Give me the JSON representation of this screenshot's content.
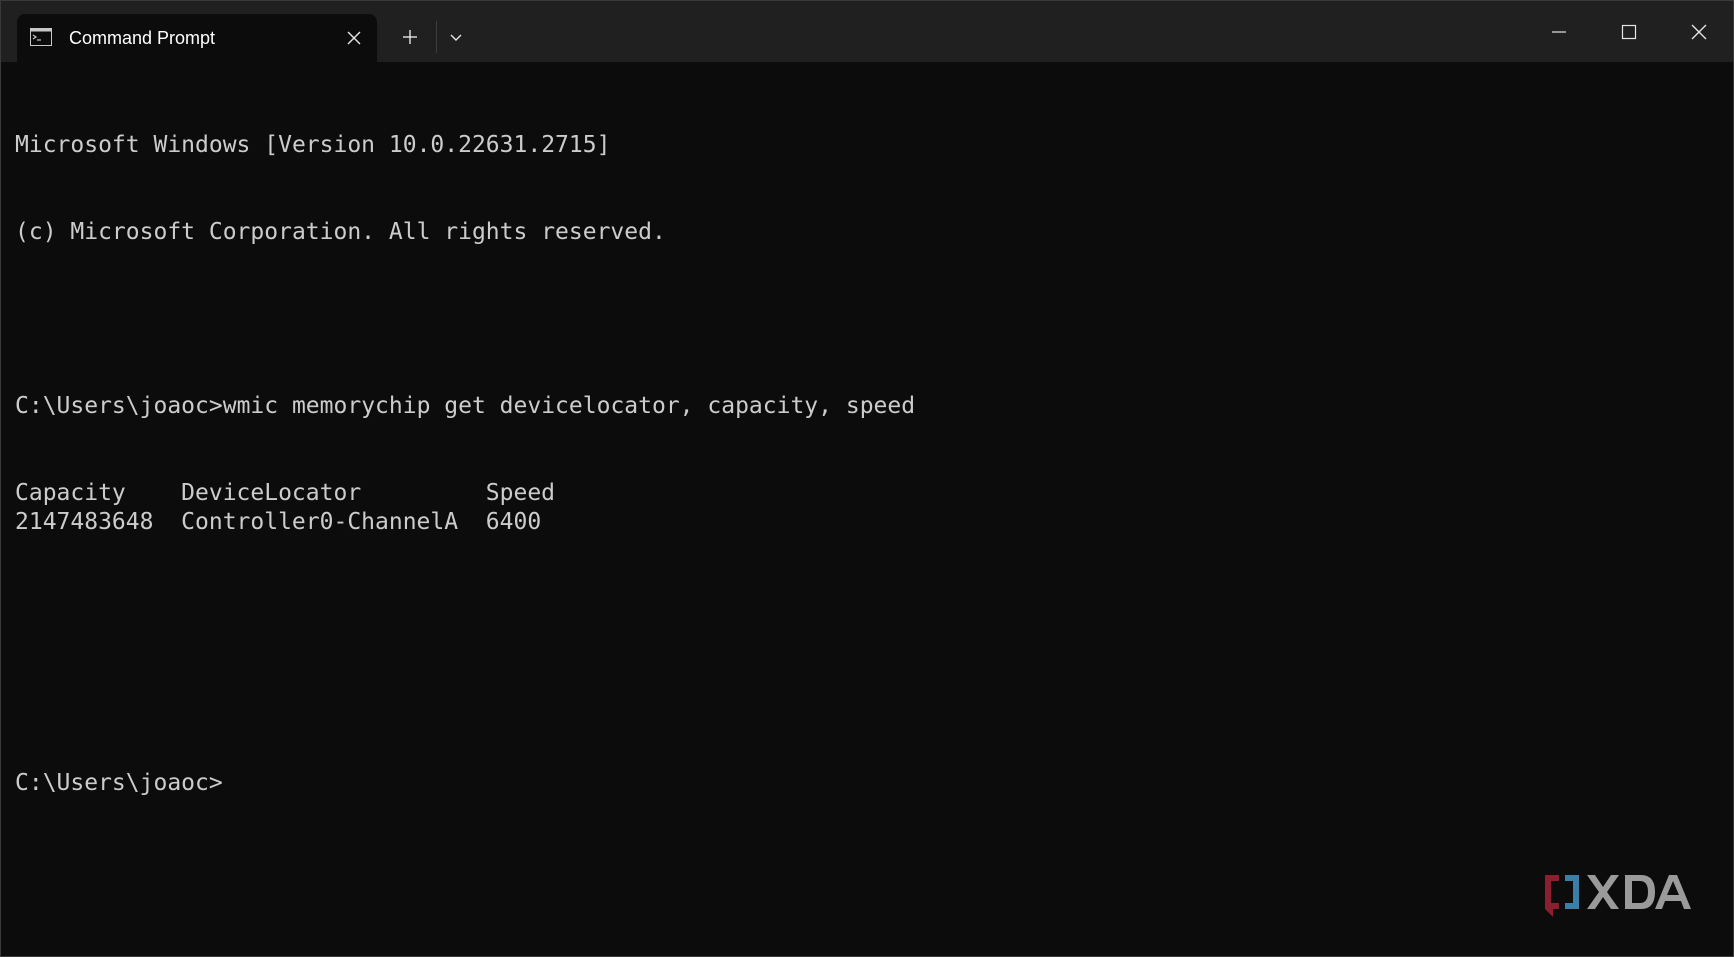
{
  "window": {
    "tab_title": "Command Prompt",
    "icons": {
      "tab": "cmd-icon",
      "close_tab": "close-icon",
      "new_tab": "plus-icon",
      "dropdown": "chevron-down-icon",
      "minimize": "minimize-icon",
      "maximize": "maximize-icon",
      "close_window": "close-icon"
    }
  },
  "terminal": {
    "header_line1": "Microsoft Windows [Version 10.0.22631.2715]",
    "header_line2": "(c) Microsoft Corporation. All rights reserved.",
    "prompt1": "C:\\Users\\joaoc>",
    "command": "wmic memorychip get devicelocator, capacity, speed",
    "output_header": {
      "capacity": "Capacity",
      "device_locator": "DeviceLocator",
      "speed": "Speed"
    },
    "output_rows": [
      {
        "capacity": "2147483648",
        "device_locator": "Controller0-ChannelA",
        "speed": "6400"
      }
    ],
    "prompt2": "C:\\Users\\joaoc>"
  },
  "colors": {
    "background": "#0c0c0c",
    "titlebar": "#202020",
    "text": "#cccccc",
    "watermark_red": "#8b1e2f",
    "watermark_blue": "#3a7fa8",
    "watermark_gray": "#9a9a9a"
  }
}
